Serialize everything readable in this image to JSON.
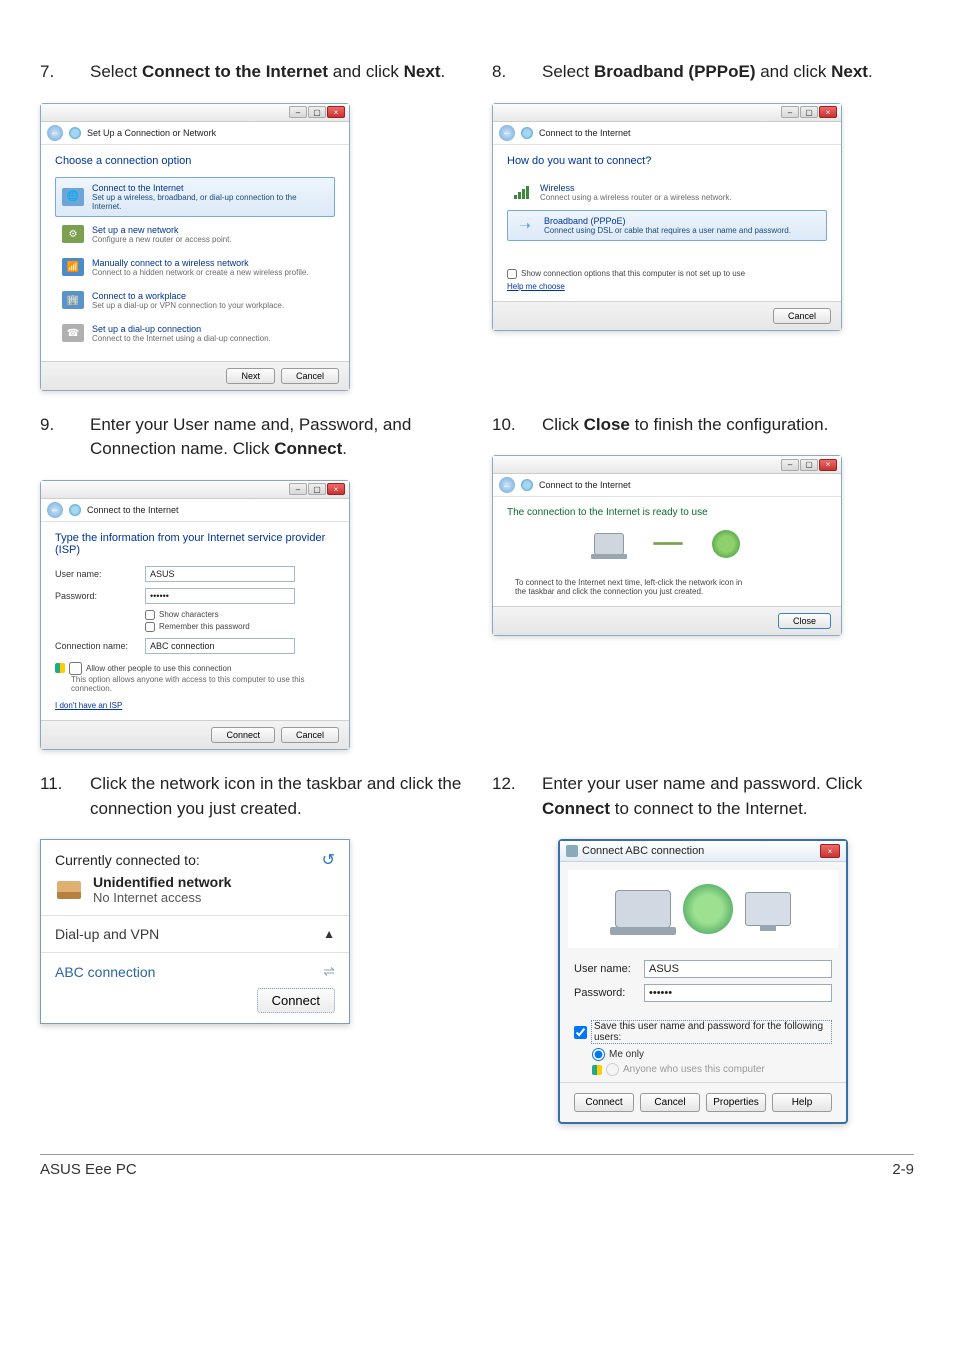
{
  "steps": {
    "s7": {
      "num": "7.",
      "text_pre": "Select ",
      "bold1": "Connect to the Internet",
      "mid": " and click ",
      "bold2": "Next",
      "suffix": "."
    },
    "s8": {
      "num": "8.",
      "text_pre": "Select ",
      "bold1": "Broadband (PPPoE)",
      "mid": " and click ",
      "bold2": "Next",
      "suffix": "."
    },
    "s9": {
      "num": "9.",
      "text": "Enter your User name and, Password, and Connection name. Click ",
      "bold": "Connect",
      "suffix": "."
    },
    "s10": {
      "num": "10.",
      "text_pre": "Click ",
      "bold": "Close",
      "text_post": " to finish the configuration."
    },
    "s11": {
      "num": "11.",
      "text": "Click the network icon in the taskbar and click the connection you just created."
    },
    "s12": {
      "num": "12.",
      "text_pre": "Enter your user name and password. Click ",
      "bold": "Connect",
      "text_post": " to connect to the Internet."
    }
  },
  "dialog7": {
    "title": "Set Up a Connection or Network",
    "heading": "Choose a connection option",
    "options": [
      {
        "title": "Connect to the Internet",
        "desc": "Set up a wireless, broadband, or dial-up connection to the Internet."
      },
      {
        "title": "Set up a new network",
        "desc": "Configure a new router or access point."
      },
      {
        "title": "Manually connect to a wireless network",
        "desc": "Connect to a hidden network or create a new wireless profile."
      },
      {
        "title": "Connect to a workplace",
        "desc": "Set up a dial-up or VPN connection to your workplace."
      },
      {
        "title": "Set up a dial-up connection",
        "desc": "Connect to the Internet using a dial-up connection."
      }
    ],
    "next": "Next",
    "cancel": "Cancel"
  },
  "dialog8": {
    "title": "Connect to the Internet",
    "heading": "How do you want to connect?",
    "options": [
      {
        "title": "Wireless",
        "desc": "Connect using a wireless router or a wireless network."
      },
      {
        "title": "Broadband (PPPoE)",
        "desc": "Connect using DSL or cable that requires a user name and password."
      }
    ],
    "show_opts": "Show connection options that this computer is not set up to use",
    "help": "Help me choose",
    "cancel": "Cancel"
  },
  "dialog9": {
    "title": "Connect to the Internet",
    "heading": "Type the information from your Internet service provider (ISP)",
    "user_label": "User name:",
    "user_val": "ASUS",
    "pass_label": "Password:",
    "pass_val": "••••••",
    "show_chars": "Show characters",
    "remember": "Remember this password",
    "conn_label": "Connection name:",
    "conn_val": "ABC connection",
    "allow": "Allow other people to use this connection",
    "allow_desc": "This option allows anyone with access to this computer to use this connection.",
    "no_isp": "I don't have an ISP",
    "connect": "Connect",
    "cancel": "Cancel"
  },
  "dialog10": {
    "title": "Connect to the Internet",
    "ready": "The connection to the Internet is ready to use",
    "tip1": "To connect to the Internet next time, left-click the network icon in",
    "tip2": "the taskbar and click the connection you just created.",
    "close": "Close"
  },
  "flyout": {
    "header": "Currently connected to:",
    "net_name": "Unidentified network",
    "net_status": "No Internet access",
    "vpn_header": "Dial-up and VPN",
    "abc": "ABC connection",
    "connect": "Connect"
  },
  "conn": {
    "title": "Connect ABC connection",
    "user_label": "User name:",
    "user_val": "ASUS",
    "pass_label": "Password:",
    "pass_val": "••••••",
    "save_label": "Save this user name and password for the following users:",
    "me_only": "Me only",
    "anyone": "Anyone who uses this computer",
    "btn_connect": "Connect",
    "btn_cancel": "Cancel",
    "btn_props": "Properties",
    "btn_help": "Help"
  },
  "footer": {
    "left": "ASUS Eee PC",
    "right": "2-9"
  }
}
